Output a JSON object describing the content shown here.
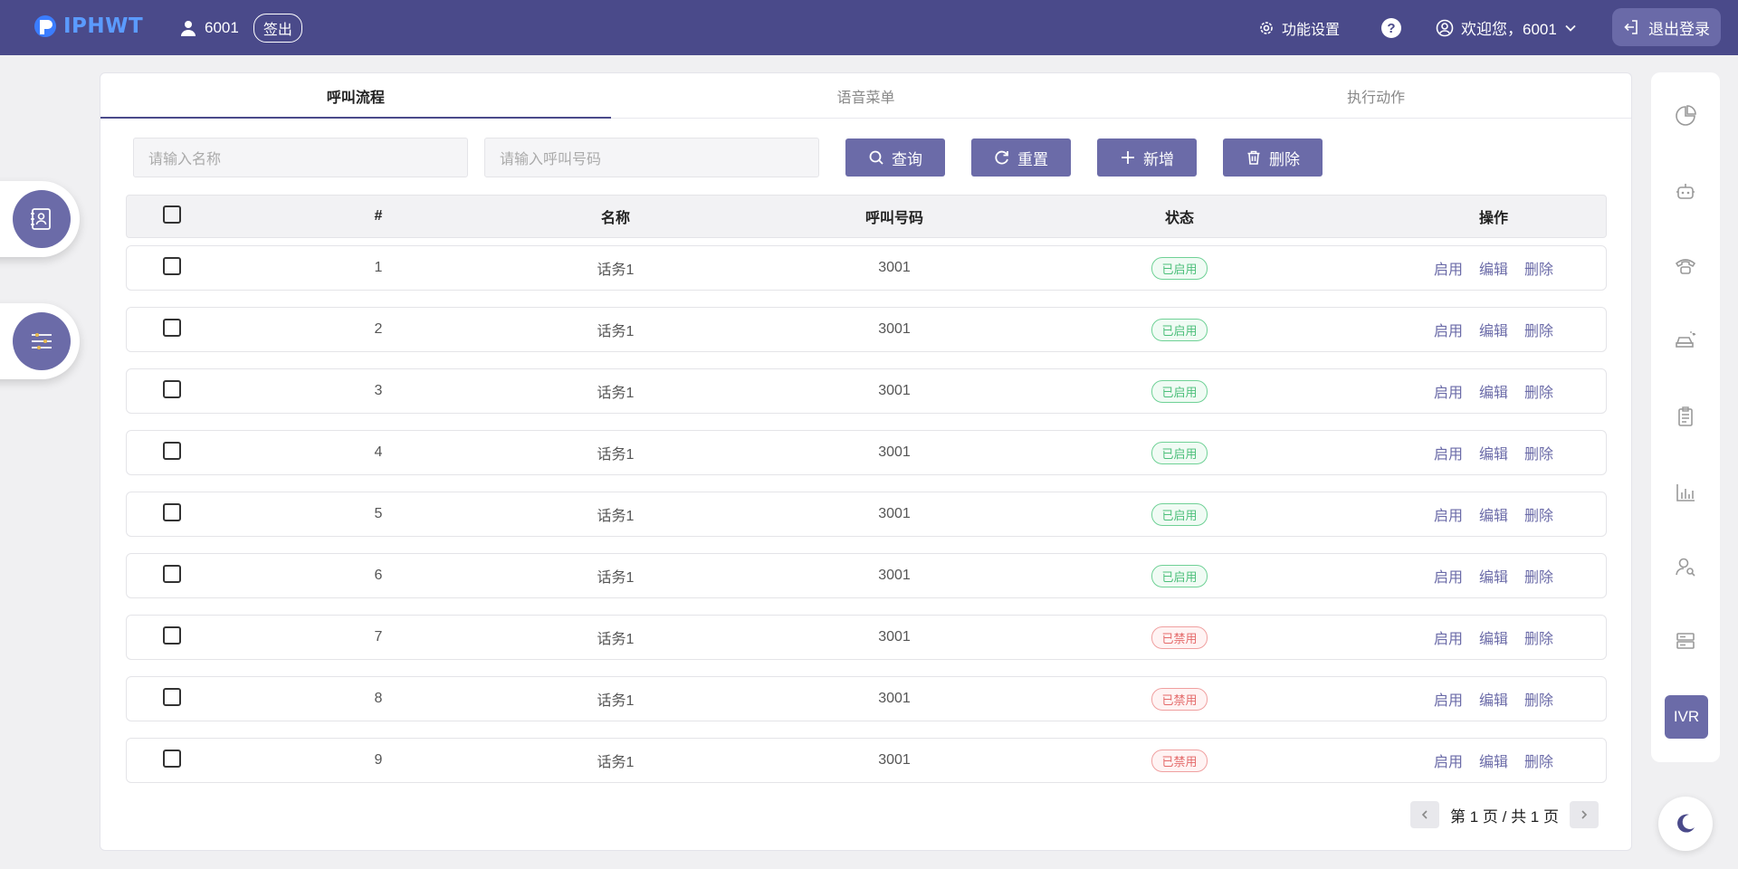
{
  "header": {
    "logo_text": "IPHWT",
    "user_id": "6001",
    "signout_label": "签出",
    "func_settings_label": "功能设置",
    "help_label": "?",
    "welcome_label": "欢迎您，6001",
    "logout_label": "退出登录"
  },
  "tabs": [
    {
      "label": "呼叫流程",
      "active": true
    },
    {
      "label": "语音菜单",
      "active": false
    },
    {
      "label": "执行动作",
      "active": false
    }
  ],
  "filters": {
    "name_placeholder": "请输入名称",
    "code_placeholder": "请输入呼叫号码",
    "query_label": "查询",
    "reset_label": "重置",
    "add_label": "新增",
    "delete_label": "删除"
  },
  "table": {
    "headers": {
      "num": "#",
      "name": "名称",
      "code": "呼叫号码",
      "status": "状态",
      "ops": "操作"
    },
    "op_enable": "启用",
    "op_edit": "编辑",
    "op_delete": "删除",
    "rows": [
      {
        "num": "1",
        "name": "话务1",
        "code": "3001",
        "status": "已启用",
        "enabled": true
      },
      {
        "num": "2",
        "name": "话务1",
        "code": "3001",
        "status": "已启用",
        "enabled": true
      },
      {
        "num": "3",
        "name": "话务1",
        "code": "3001",
        "status": "已启用",
        "enabled": true
      },
      {
        "num": "4",
        "name": "话务1",
        "code": "3001",
        "status": "已启用",
        "enabled": true
      },
      {
        "num": "5",
        "name": "话务1",
        "code": "3001",
        "status": "已启用",
        "enabled": true
      },
      {
        "num": "6",
        "name": "话务1",
        "code": "3001",
        "status": "已启用",
        "enabled": true
      },
      {
        "num": "7",
        "name": "话务1",
        "code": "3001",
        "status": "已禁用",
        "enabled": false
      },
      {
        "num": "8",
        "name": "话务1",
        "code": "3001",
        "status": "已禁用",
        "enabled": false
      },
      {
        "num": "9",
        "name": "话务1",
        "code": "3001",
        "status": "已禁用",
        "enabled": false
      }
    ]
  },
  "pager": {
    "label": "第 1 页 / 共 1 页"
  },
  "right_sidebar": {
    "icons": [
      "pie-chart-icon",
      "robot-icon",
      "telephone-icon",
      "car-icon",
      "clipboard-icon",
      "bar-chart-icon",
      "user-search-icon",
      "server-icon"
    ],
    "ivr_label": "IVR"
  },
  "colors": {
    "primary": "#4a4a8a",
    "accent": "#6b6ba8",
    "enabled": "#4cbf7a",
    "disabled": "#e46a6a"
  }
}
